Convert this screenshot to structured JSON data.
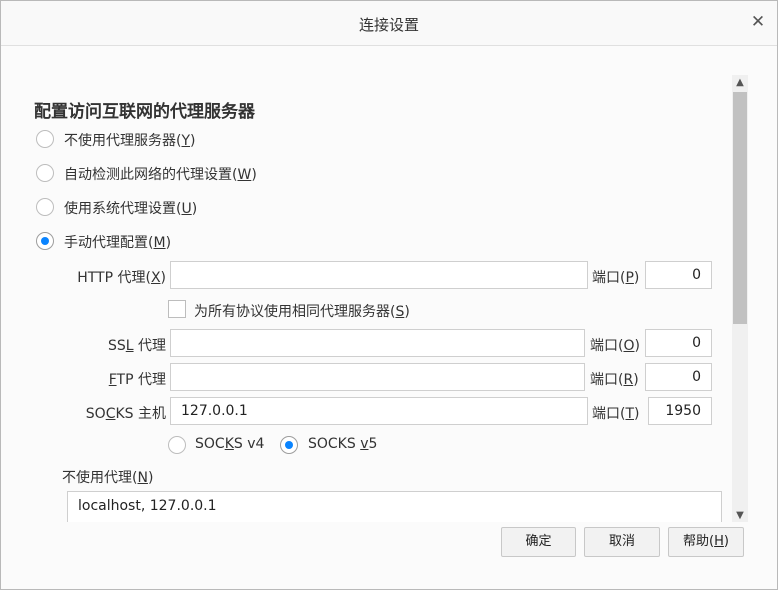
{
  "window": {
    "title": "连接设置"
  },
  "section": {
    "heading": "配置访问互联网的代理服务器"
  },
  "proxy_options": {
    "none": {
      "text": "不使用代理服务器(",
      "key": "Y",
      "end": ")"
    },
    "auto_detect": {
      "text": "自动检测此网络的代理设置(",
      "key": "W",
      "end": ")"
    },
    "system": {
      "text": "使用系统代理设置(",
      "key": "U",
      "end": ")"
    },
    "manual": {
      "text": "手动代理配置(",
      "key": "M",
      "end": ")"
    },
    "selected": "manual"
  },
  "http": {
    "label_pre": "HTTP 代理(",
    "key": "X",
    "label_post": ")",
    "value": "",
    "port_pre": "端口(",
    "port_key": "P",
    "port_post": ")",
    "port": "0"
  },
  "share": {
    "text": "为所有协议使用相同代理服务器(",
    "key": "S",
    "end": ")",
    "checked": false
  },
  "ssl": {
    "label_pre": "SS",
    "key": "L",
    "label_post": " 代理",
    "value": "",
    "port_pre": "端口(",
    "port_key": "O",
    "port_post": ")",
    "port": "0"
  },
  "ftp": {
    "label_pre": "",
    "key": "F",
    "label_post": "TP 代理",
    "value": "",
    "port_pre": "端口(",
    "port_key": "R",
    "port_post": ")",
    "port": "0"
  },
  "socks": {
    "label_pre": "SO",
    "key": "C",
    "label_post": "KS 主机",
    "value": "127.0.0.1",
    "port_pre": "端口(",
    "port_key": "T",
    "port_post": ")",
    "port": "1950"
  },
  "socks_version": {
    "v4": {
      "pre": "SOC",
      "key": "K",
      "post": "S v4"
    },
    "v5": {
      "pre": "SOCKS ",
      "key": "v",
      "post": "5"
    },
    "selected": "v5"
  },
  "no_proxy": {
    "label_pre": "不使用代理(",
    "key": "N",
    "label_post": ")",
    "value": "localhost, 127.0.0.1"
  },
  "buttons": {
    "ok": "确定",
    "cancel": "取消",
    "help_pre": "帮助(",
    "help_key": "H",
    "help_post": ")"
  }
}
